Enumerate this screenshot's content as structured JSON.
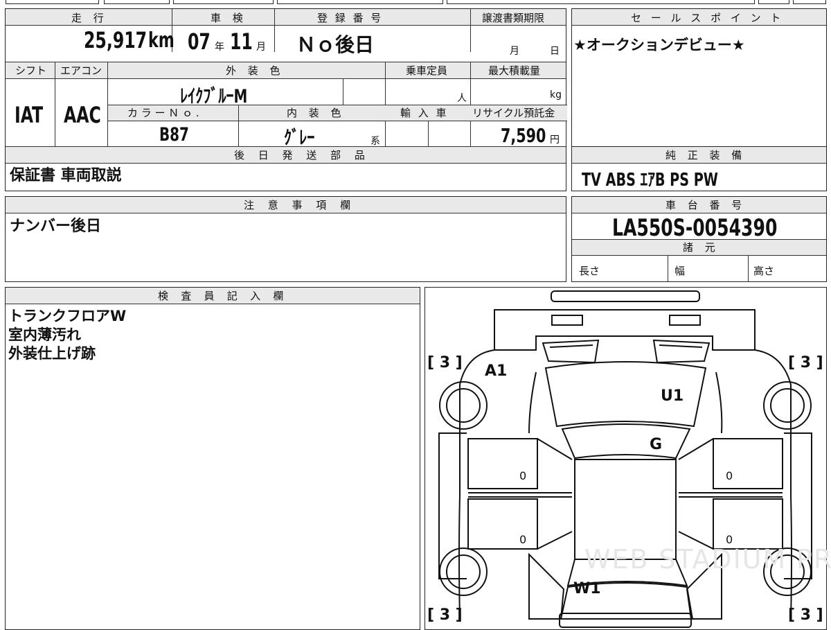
{
  "vehicle": {
    "mileage_header": "走 行",
    "mileage_value": "25,917",
    "mileage_unit": "km",
    "inspection_header": "車 検",
    "inspection_year": "07",
    "year_unit": "年",
    "inspection_month": "11",
    "month_unit": "月",
    "registration_header": "登 録 番 号",
    "registration_value": "Ｎｏ後日",
    "transfer_header": "譲渡書類期限",
    "transfer_month_unit": "月",
    "transfer_day_unit": "日",
    "shift_header": "シフト",
    "shift_value": "IAT",
    "aircon_header": "エアコン",
    "aircon_value": "AAC",
    "exterior_header": "外 装 色",
    "exterior_value": "ﾚｲｸﾌﾞﾙｰM",
    "capacity_header": "乗車定員",
    "capacity_unit": "人",
    "maxload_header": "最大積載量",
    "maxload_unit": "kg",
    "colorno_header": "カ ラ ー Ｎ ｏ .",
    "colorno_value": "B87",
    "interior_header": "内 装 色",
    "interior_value": "ｸﾞﾚｰ",
    "interior_suffix": "系",
    "import_header": "輸 入 車",
    "recycle_header": "リサイクル預託金",
    "recycle_value": "7,590",
    "recycle_unit": "円"
  },
  "sales_points": {
    "header": "セ ー ル ス ポ イ ン ト",
    "text": "★オークションデビュー★"
  },
  "later_parts": {
    "header": "後 日 発 送 部 品",
    "text": "保証書 車両取説"
  },
  "equipment": {
    "header": "純 正 装 備",
    "text": "TV  ABS  ｴｱB  PS  PW"
  },
  "notes": {
    "header": "注 意 事 項 欄",
    "text": "ナンバー後日"
  },
  "chassis": {
    "header": "車 台 番 号",
    "value": "LA550S-0054390",
    "specs_header": "諸 元",
    "length_label": "長さ",
    "width_label": "幅",
    "height_label": "高さ"
  },
  "inspector": {
    "header": "検 査 員 記 入 欄",
    "lines": [
      "トランクフロアW",
      "室内薄汚れ",
      "外装仕上げ跡"
    ]
  },
  "diagram": {
    "tire_marks": [
      "[ 3 ]",
      "[ 3 ]",
      "[ 3 ]",
      "[ 3 ]"
    ],
    "damage_codes": [
      "A1",
      "U1",
      "G",
      "W1"
    ],
    "zero_marks": [
      "0",
      "0",
      "0",
      "0"
    ],
    "watermark": "WEB STADIUM PRO"
  }
}
